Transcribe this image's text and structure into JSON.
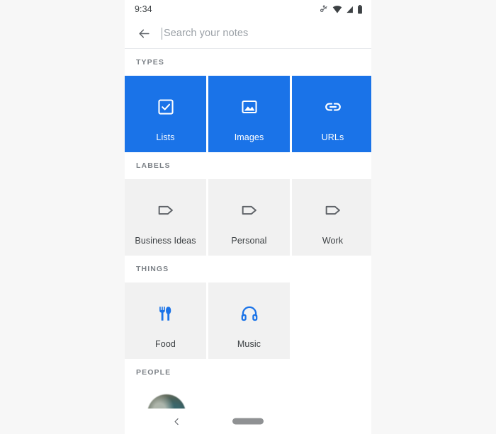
{
  "status_bar": {
    "time": "9:34",
    "icons": [
      {
        "name": "vpn-key-icon"
      },
      {
        "name": "wifi-icon"
      },
      {
        "name": "cell-signal-icon"
      },
      {
        "name": "battery-icon"
      }
    ]
  },
  "search": {
    "back_icon": "back-arrow-icon",
    "placeholder": "Search your notes",
    "value": ""
  },
  "sections": [
    {
      "key": "types",
      "title": "TYPES",
      "style": "blue",
      "tiles": [
        {
          "label": "Lists",
          "icon": "checkbox-icon"
        },
        {
          "label": "Images",
          "icon": "image-icon"
        },
        {
          "label": "URLs",
          "icon": "link-icon"
        }
      ]
    },
    {
      "key": "labels",
      "title": "LABELS",
      "style": "grey",
      "tiles": [
        {
          "label": "Business Ideas",
          "icon": "label-tag-icon"
        },
        {
          "label": "Personal",
          "icon": "label-tag-icon"
        },
        {
          "label": "Work",
          "icon": "label-tag-icon"
        }
      ]
    },
    {
      "key": "things",
      "title": "THINGS",
      "style": "grey",
      "tiles": [
        {
          "label": "Food",
          "icon": "restaurant-icon"
        },
        {
          "label": "Music",
          "icon": "headphones-icon"
        }
      ]
    },
    {
      "key": "people",
      "title": "PEOPLE",
      "style": "people",
      "tiles": [
        {
          "label": "",
          "icon": "person-avatar"
        }
      ]
    }
  ],
  "nav_bar": {
    "back_icon": "nav-back-chevron-icon",
    "home_icon": "nav-home-pill"
  },
  "colors": {
    "accent_blue": "#1a73e8",
    "tile_grey": "#f1f1f1",
    "page_background": "#f7f7f7",
    "icon_grey": "#5f6368",
    "label_grey": "#7a7f85"
  }
}
